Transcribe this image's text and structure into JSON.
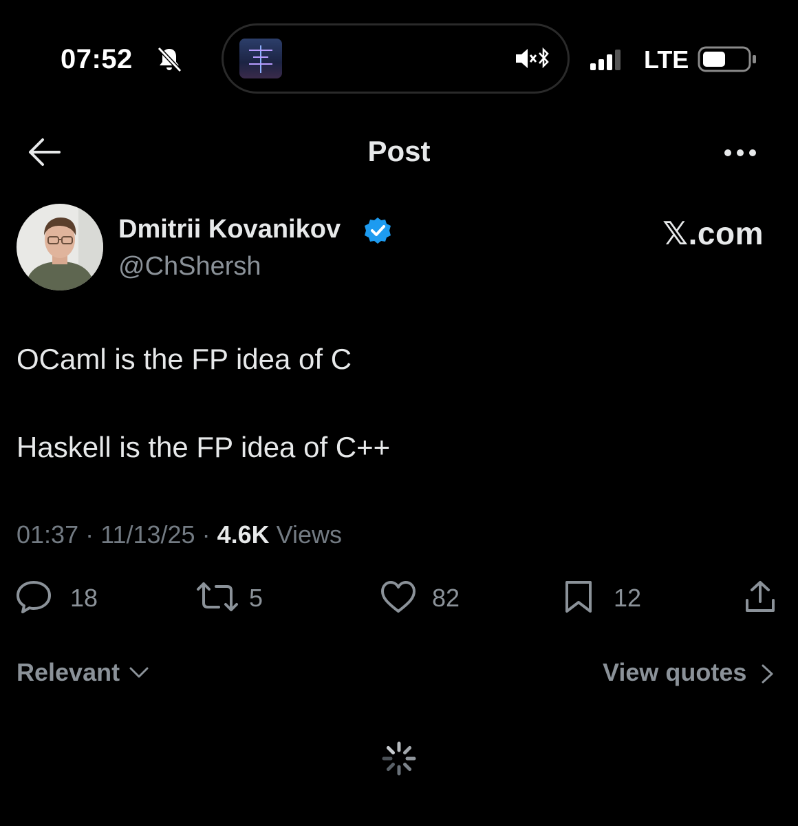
{
  "status_bar": {
    "time": "07:52",
    "network": "LTE"
  },
  "header": {
    "title": "Post"
  },
  "author": {
    "name": "Dmitrii Kovanikov",
    "handle": "@ChShersh",
    "source_label": "𝕏.com"
  },
  "post": {
    "lines": [
      "OCaml is the FP idea of C",
      "Haskell is the FP idea of C++"
    ],
    "time": "01:37",
    "date": "11/13/25",
    "views_count": "4.6K",
    "views_label": "Views"
  },
  "actions": {
    "replies": "18",
    "reposts": "5",
    "likes": "82",
    "bookmarks": "12"
  },
  "footer": {
    "sort_label": "Relevant",
    "view_quotes_label": "View quotes"
  },
  "colors": {
    "background": "#000000",
    "text": "#e7e9ea",
    "muted": "#8b9299",
    "verified": "#1d9bf0"
  },
  "icons": [
    "bell-muted-icon",
    "speaker-muted-icon",
    "bluetooth-icon",
    "signal-icon",
    "battery-icon",
    "back-arrow-icon",
    "more-icon",
    "verified-badge-icon",
    "reply-icon",
    "repost-icon",
    "like-icon",
    "bookmark-icon",
    "share-icon",
    "chevron-down-icon",
    "chevron-right-icon",
    "loading-spinner-icon"
  ]
}
